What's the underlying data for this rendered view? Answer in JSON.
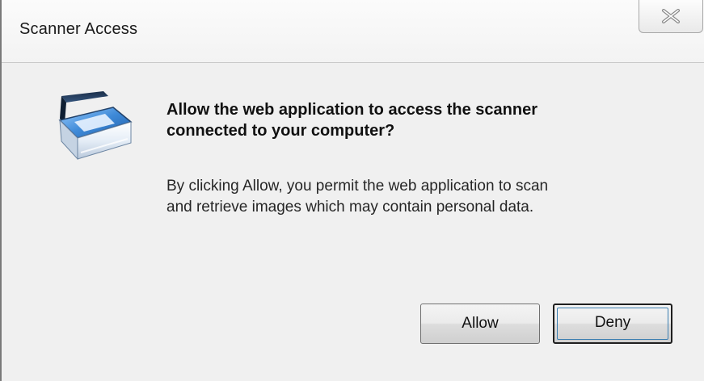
{
  "window": {
    "title": "Scanner Access",
    "close_icon": "close-icon"
  },
  "dialog": {
    "icon": "scanner-icon",
    "heading_line1": "Allow the web application to access the scanner",
    "heading_line2": "connected to your computer?",
    "body_line1": "By clicking Allow, you permit the web application to scan",
    "body_line2": "and retrieve images which may contain personal data."
  },
  "buttons": {
    "allow_label": "Allow",
    "deny_label": "Deny"
  },
  "colors": {
    "dialog_background": "#f0f0f0",
    "focus_ring": "#3c7fb1",
    "scanner_blue": "#2f78c4"
  }
}
